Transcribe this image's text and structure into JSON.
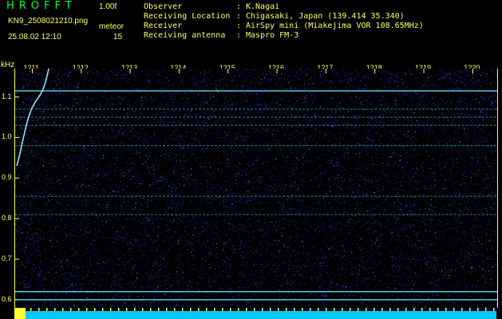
{
  "header": {
    "brand": "HROFFT",
    "version": "1.00f",
    "filename": "KN9_2508021210.png",
    "meteor_label": "meteor",
    "datetime": "25.08.02 12:10",
    "meteor_count": "15"
  },
  "info": [
    {
      "key": "Observer",
      "value": "K.Nagai"
    },
    {
      "key": "Receiving Location",
      "value": "Chigasaki, Japan (139.414 35.340)"
    },
    {
      "key": "Receiver",
      "value": "AirSpy mini (Miakejima VOR 108.65MHz)"
    },
    {
      "key": "Receiving antenna",
      "value": "Maspro FM-3"
    }
  ],
  "info_separator": ":",
  "chart_data": {
    "type": "heatmap",
    "title": "",
    "ylabel": "kHz",
    "xlabel": "",
    "y_ticks": [
      "1.1",
      "1.0",
      "0.9",
      "0.8",
      "0.7",
      "0.6"
    ],
    "x_ticks": [
      "1211",
      "1212",
      "1213",
      "1214",
      "1215",
      "1216",
      "1217",
      "1218",
      "1219",
      "1220"
    ],
    "ylim": [
      0.58,
      1.17
    ],
    "xlim": [
      1210.65,
      1220.5
    ],
    "carrier_lines_khz": [
      1.115,
      1.07,
      1.05,
      1.03,
      0.98,
      0.855,
      0.81,
      0.62,
      0.6
    ],
    "meteor_trace_khz_range": [
      0.93,
      1.17
    ],
    "colors": {
      "background": "#000000",
      "noise_low": "#08083a",
      "noise_high": "#3f5fff",
      "lines": "#3fd0ff",
      "axis": "#ffff66",
      "bar": "#00c8ff"
    }
  }
}
